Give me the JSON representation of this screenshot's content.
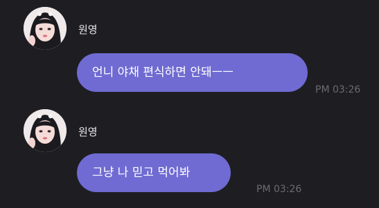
{
  "messages": [
    {
      "sender": "원영",
      "text": "언니 야채 편식하면 안돼ㅡㅡ",
      "time": "PM 03:26"
    },
    {
      "sender": "원영",
      "text": "그냥 나 믿고 먹어봐",
      "time": "PM 03:26"
    }
  ],
  "colors": {
    "background": "#1e1e22",
    "bubble": "#6f6bd2",
    "bubble_text": "#ffffff",
    "sender_text": "#e9e9ec",
    "time_text": "#6b6b70"
  }
}
